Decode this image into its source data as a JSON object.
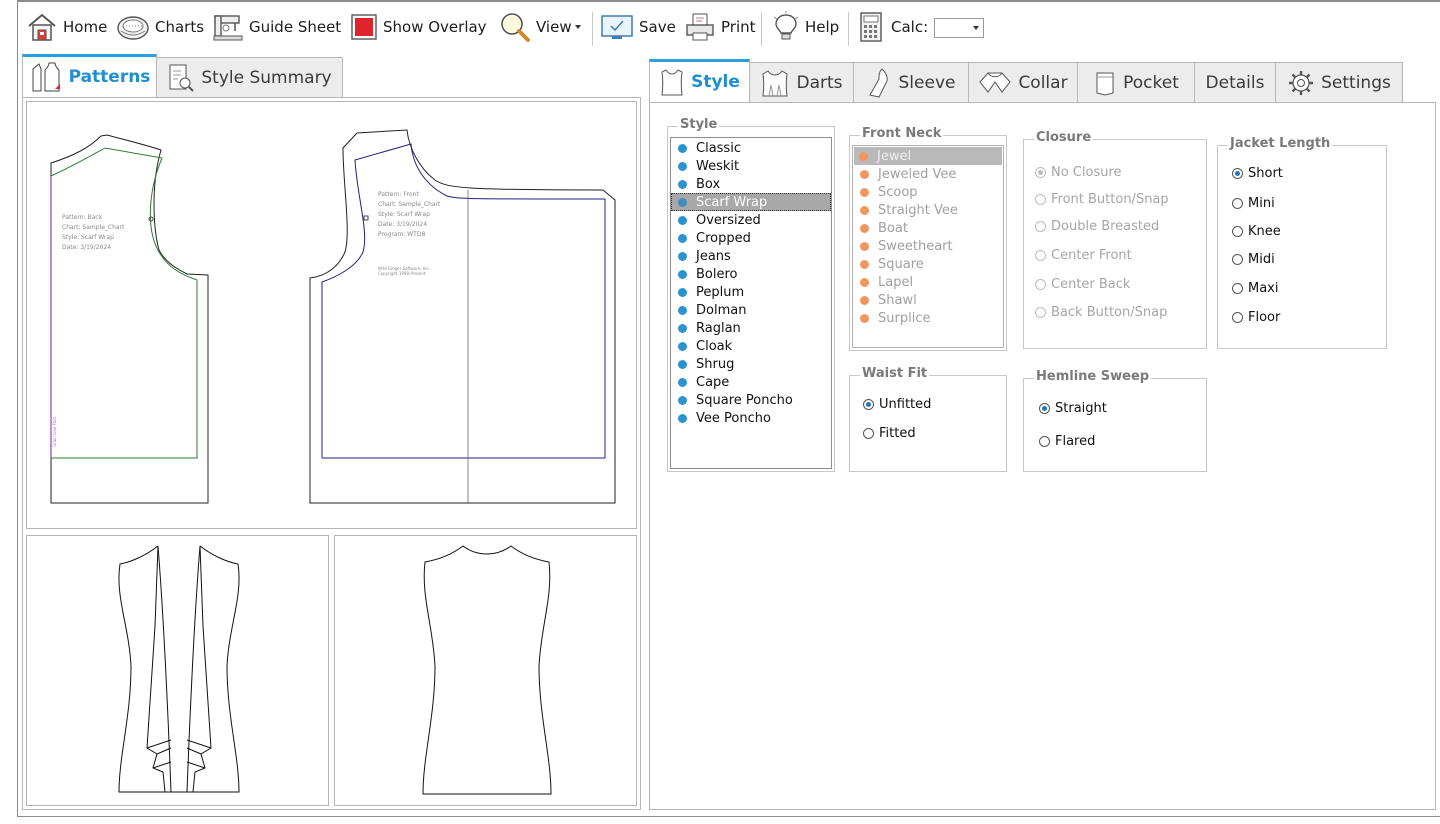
{
  "toolbar": {
    "home": "Home",
    "charts": "Charts",
    "guide_sheet": "Guide Sheet",
    "show_overlay": "Show Overlay",
    "view": "View",
    "save": "Save",
    "print": "Print",
    "help": "Help",
    "calc": "Calc:",
    "calc_value": ""
  },
  "left_tabs": [
    {
      "label": "Patterns",
      "active": true
    },
    {
      "label": "Style Summary",
      "active": false
    }
  ],
  "pattern_back": {
    "lines": [
      "Pattern: Back",
      "Chart: Sample_Chart",
      "Style: Scarf Wrap",
      "Date: 3/19/2024"
    ],
    "side_label": "Grain Line Fold"
  },
  "pattern_front": {
    "lines": [
      "Pattern: Front",
      "Chart: Sample_Chart",
      "Style: Scarf Wrap",
      "Date: 3/19/2024",
      "Program: WTD8"
    ],
    "copyright": [
      "Wild Ginger Software, Inc.",
      "Copyright 1998-Present"
    ]
  },
  "right_tabs": [
    {
      "label": "Style",
      "active": true
    },
    {
      "label": "Darts"
    },
    {
      "label": "Sleeve"
    },
    {
      "label": "Collar"
    },
    {
      "label": "Pocket"
    },
    {
      "label": "Details"
    },
    {
      "label": "Settings"
    }
  ],
  "style": {
    "title": "Style",
    "items": [
      "Classic",
      "Weskit",
      "Box",
      "Scarf Wrap",
      "Oversized",
      "Cropped",
      "Jeans",
      "Bolero",
      "Peplum",
      "Dolman",
      "Raglan",
      "Cloak",
      "Shrug",
      "Cape",
      "Square Poncho",
      "Vee Poncho"
    ],
    "selected": "Scarf Wrap"
  },
  "front_neck": {
    "title": "Front Neck",
    "items": [
      "Jewel",
      "Jeweled Vee",
      "Scoop",
      "Straight Vee",
      "Boat",
      "Sweetheart",
      "Square",
      "Lapel",
      "Shawl",
      "Surplice"
    ],
    "selected": "Jewel"
  },
  "closure": {
    "title": "Closure",
    "options": [
      "No Closure",
      "Front Button/Snap",
      "Double Breasted",
      "Center Front",
      "Center Back",
      "Back Button/Snap"
    ],
    "selected": "No Closure"
  },
  "jacket_length": {
    "title": "Jacket Length",
    "options": [
      "Short",
      "Mini",
      "Knee",
      "Midi",
      "Maxi",
      "Floor"
    ],
    "selected": "Short"
  },
  "waist_fit": {
    "title": "Waist Fit",
    "options": [
      "Unfitted",
      "Fitted"
    ],
    "selected": "Unfitted"
  },
  "hemline_sweep": {
    "title": "Hemline Sweep",
    "options": [
      "Straight",
      "Flared"
    ],
    "selected": "Straight"
  },
  "colors": {
    "accent": "#1f8fcf",
    "style_dot": "#2b93cf",
    "neck_dot": "#f1965f",
    "overlay_red": "#e0242b",
    "back_pattern_line": "#2e7d32",
    "front_pattern_line": "#1a237e"
  }
}
